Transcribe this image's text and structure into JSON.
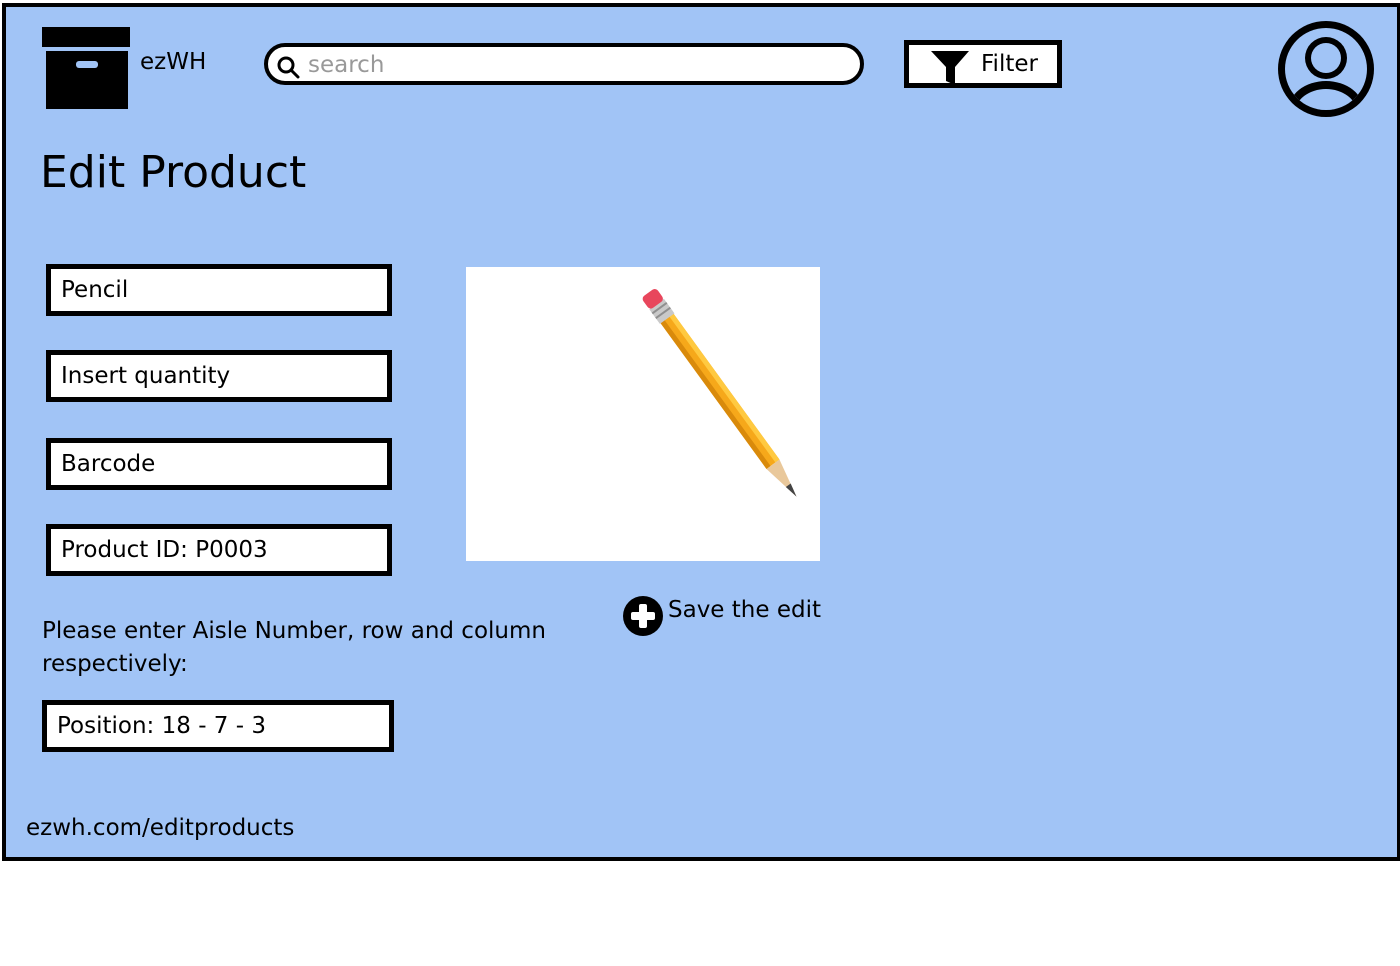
{
  "header": {
    "app_name": "ezWH",
    "search_placeholder": "search",
    "filter_label": "Filter"
  },
  "page": {
    "title": "Edit Product"
  },
  "form": {
    "name_value": "Pencil",
    "quantity_placeholder": "Insert quantity",
    "barcode_placeholder": "Barcode",
    "product_id": "Product ID: P0003",
    "instructions": "Please enter Aisle Number, row and column respectively:",
    "position": "Position: 18 - 7 - 3"
  },
  "actions": {
    "save_label": "Save the edit"
  },
  "footer": {
    "url": "ezwh.com/editproducts"
  },
  "icons": {
    "logo": "archive-box-icon",
    "search": "search-icon",
    "filter": "funnel-icon",
    "avatar": "user-avatar-icon",
    "save": "plus-circle-icon"
  },
  "colors": {
    "background": "#a1c4f6",
    "border": "#000000",
    "field_bg": "#ffffff"
  }
}
